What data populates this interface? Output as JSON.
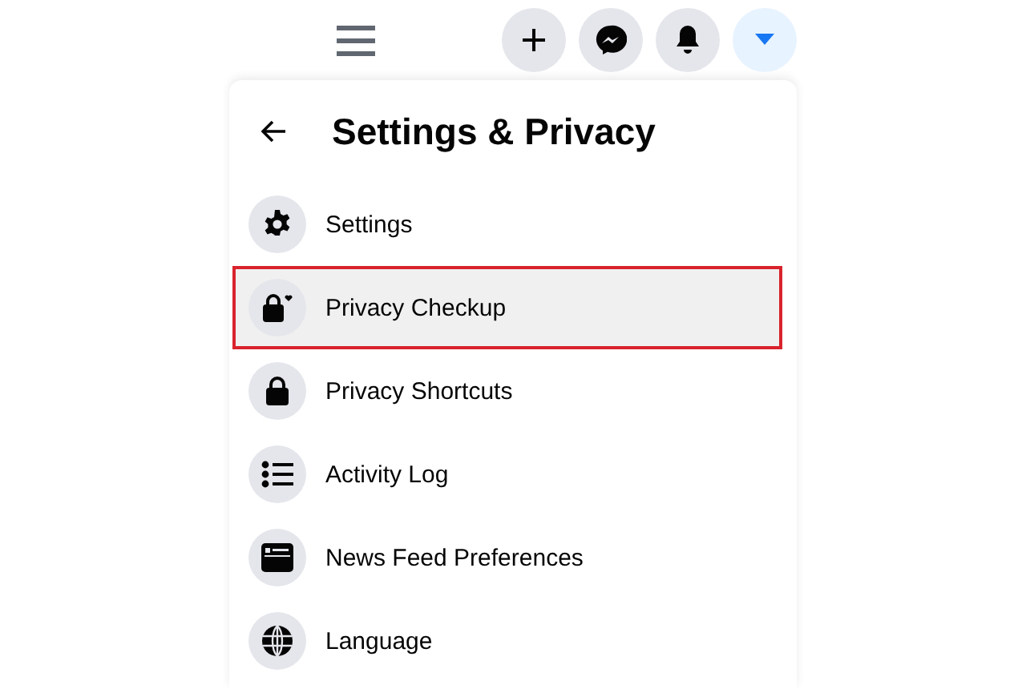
{
  "top_bar": {
    "menu_selected": false,
    "buttons": [
      {
        "kind": "plus",
        "selected": false
      },
      {
        "kind": "messenger",
        "selected": false
      },
      {
        "kind": "bell",
        "selected": false
      },
      {
        "kind": "caret",
        "selected": true
      }
    ]
  },
  "panel": {
    "title": "Settings & Privacy",
    "items": [
      {
        "kind": "gear",
        "label": "Settings",
        "selected": false
      },
      {
        "kind": "lock-heart",
        "label": "Privacy Checkup",
        "selected": true
      },
      {
        "kind": "lock",
        "label": "Privacy Shortcuts",
        "selected": false
      },
      {
        "kind": "list",
        "label": "Activity Log",
        "selected": false
      },
      {
        "kind": "feed",
        "label": "News Feed Preferences",
        "selected": false
      },
      {
        "kind": "globe",
        "label": "Language",
        "selected": false
      }
    ]
  }
}
